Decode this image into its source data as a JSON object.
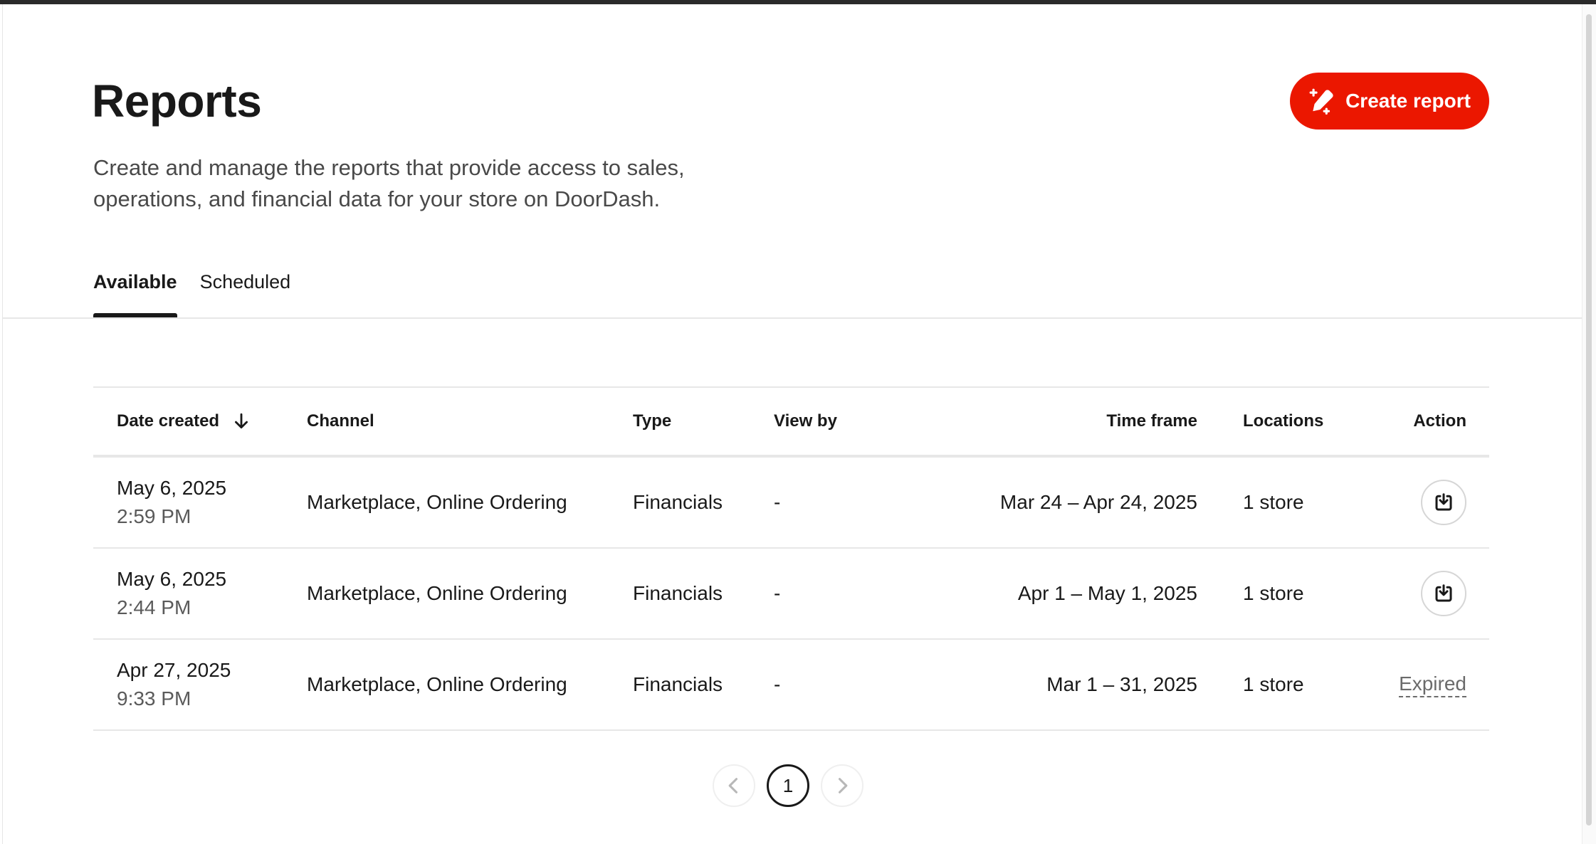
{
  "header": {
    "title": "Reports",
    "description": "Create and manage the reports that provide access to sales, operations, and financial data for your store on DoorDash.",
    "create_button_label": "Create report"
  },
  "tabs": [
    {
      "label": "Available",
      "active": true
    },
    {
      "label": "Scheduled",
      "active": false
    }
  ],
  "table": {
    "columns": {
      "date_created": "Date created",
      "channel": "Channel",
      "type": "Type",
      "view_by": "View by",
      "time_frame": "Time frame",
      "locations": "Locations",
      "action": "Action"
    },
    "rows": [
      {
        "date": "May 6, 2025",
        "time": "2:59 PM",
        "channel": "Marketplace, Online Ordering",
        "type": "Financials",
        "view_by": "-",
        "time_frame": "Mar 24 – Apr 24, 2025",
        "locations": "1 store",
        "action": "download"
      },
      {
        "date": "May 6, 2025",
        "time": "2:44 PM",
        "channel": "Marketplace, Online Ordering",
        "type": "Financials",
        "view_by": "-",
        "time_frame": "Apr 1 – May 1, 2025",
        "locations": "1 store",
        "action": "download"
      },
      {
        "date": "Apr 27, 2025",
        "time": "9:33 PM",
        "channel": "Marketplace, Online Ordering",
        "type": "Financials",
        "view_by": "-",
        "time_frame": "Mar 1 – 31, 2025",
        "locations": "1 store",
        "action": "expired",
        "action_label": "Expired"
      }
    ]
  },
  "pagination": {
    "current_page": "1"
  },
  "icons": {
    "create": "pencil-plus-icon",
    "sort": "arrow-down-icon",
    "download": "download-icon",
    "prev": "chevron-left-icon",
    "next": "chevron-right-icon"
  },
  "colors": {
    "accent": "#eb1700",
    "text": "#191919",
    "muted": "#494949",
    "divider": "#e7e7e7"
  }
}
